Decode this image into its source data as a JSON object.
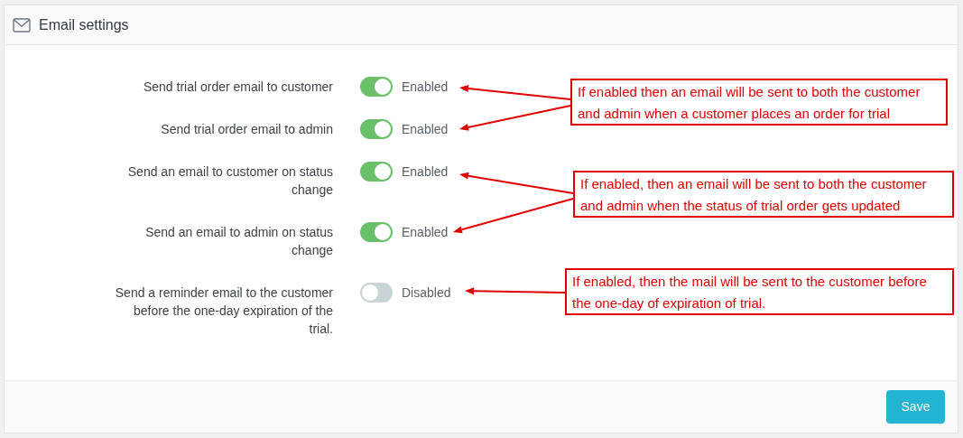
{
  "panel": {
    "title": "Email settings"
  },
  "settings": [
    {
      "label": "Send trial order email to customer",
      "on": true,
      "status": "Enabled"
    },
    {
      "label": "Send trial order email to admin",
      "on": true,
      "status": "Enabled"
    },
    {
      "label": "Send an email to customer on status change",
      "on": true,
      "status": "Enabled"
    },
    {
      "label": "Send an email to admin on status change",
      "on": true,
      "status": "Enabled"
    },
    {
      "label": "Send a reminder email to the customer before the one-day expiration of the trial.",
      "on": false,
      "status": "Disabled"
    }
  ],
  "annotations": [
    {
      "text": "If enabled then an email will be sent to both the customer and admin when a customer places an order for trial"
    },
    {
      "text": "If enabled, then an email will be sent to both the customer and admin when the status of trial order gets updated"
    },
    {
      "text": "If enabled, then the mail will be sent to the customer before the one-day of expiration of trial."
    }
  ],
  "footer": {
    "save_button": "Save"
  }
}
